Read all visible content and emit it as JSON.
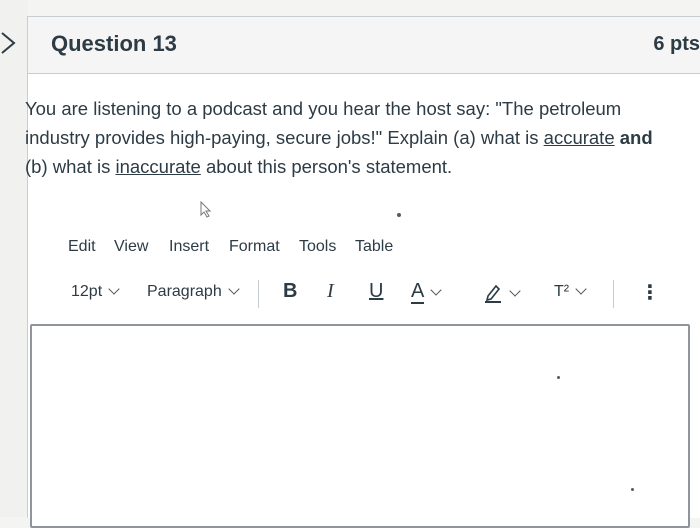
{
  "question": {
    "title": "Question 13",
    "points": "6 pts",
    "text_part1": "You are listening to a podcast and you hear the host say: \"The petroleum industry provides high-paying, secure jobs!\" Explain (a) what is ",
    "text_accurate": "accurate",
    "text_and": " and",
    "text_part2": " (b) what is ",
    "text_inaccurate": "inaccurate",
    "text_part3": " about this person's statement."
  },
  "editor": {
    "menu": [
      "Edit",
      "View",
      "Insert",
      "Format",
      "Tools",
      "Table"
    ],
    "font_size": "12pt",
    "block_format": "Paragraph",
    "bold": "B",
    "italic": "I",
    "underline": "U",
    "text_color": "A",
    "superscript": "T²",
    "more": "⋮",
    "content": ""
  },
  "icons": {
    "nav": "chevron-right-icon",
    "highlight": "highlighter-icon",
    "cursor": "mouse-pointer-icon"
  },
  "colors": {
    "text": "#2d3b45",
    "header_bg": "#f5f5f5",
    "border": "#c7cdd1"
  }
}
